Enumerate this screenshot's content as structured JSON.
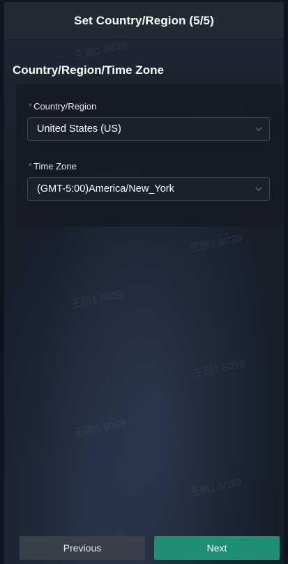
{
  "header": {
    "title": "Set Country/Region (5/5)"
  },
  "section": {
    "title": "Country/Region/Time Zone"
  },
  "form": {
    "country": {
      "label": "Country/Region",
      "required_mark": "*",
      "value": "United States (US)"
    },
    "timezone": {
      "label": "Time Zone",
      "required_mark": "*",
      "value": "(GMT-5:00)America/New_York"
    }
  },
  "footer": {
    "previous_label": "Previous",
    "next_label": "Next"
  },
  "watermark": {
    "text": "王刚1 8039"
  },
  "colors": {
    "next_button": "#1e8f72",
    "previous_button": "#3a4049",
    "required": "#e0463f"
  }
}
